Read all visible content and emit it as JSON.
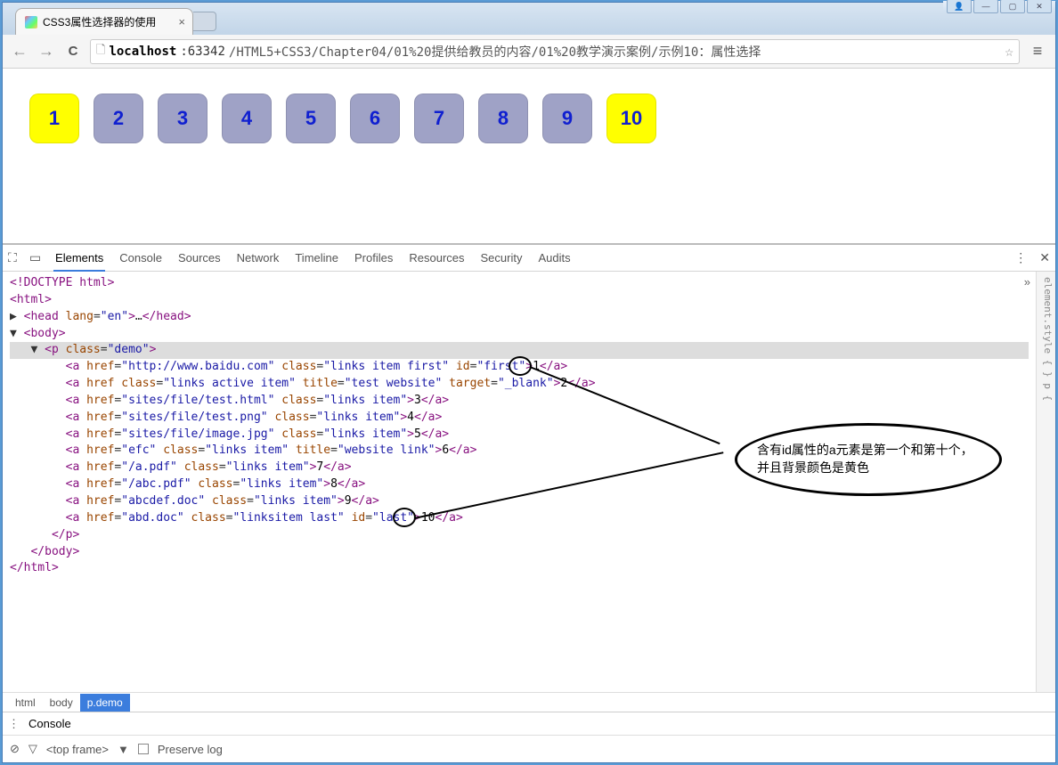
{
  "browser": {
    "tab_title": "CSS3属性选择器的使用",
    "url_host": "localhost",
    "url_port": ":63342",
    "url_path": "/HTML5+CSS3/Chapter04/01%20提供给教员的内容/01%20教学演示案例/示例10：属性选择"
  },
  "demo_items": [
    {
      "label": "1",
      "highlight": true
    },
    {
      "label": "2",
      "highlight": false
    },
    {
      "label": "3",
      "highlight": false
    },
    {
      "label": "4",
      "highlight": false
    },
    {
      "label": "5",
      "highlight": false
    },
    {
      "label": "6",
      "highlight": false
    },
    {
      "label": "7",
      "highlight": false
    },
    {
      "label": "8",
      "highlight": false
    },
    {
      "label": "9",
      "highlight": false
    },
    {
      "label": "10",
      "highlight": true
    }
  ],
  "devtools": {
    "tabs": [
      "Elements",
      "Console",
      "Sources",
      "Network",
      "Timeline",
      "Profiles",
      "Resources",
      "Security",
      "Audits"
    ],
    "active_tab": "Elements",
    "side_text": "element.style { } p {",
    "breadcrumbs": [
      "html",
      "body",
      "p.demo"
    ],
    "console_label": "Console",
    "top_frame": "<top frame>",
    "preserve_log": "Preserve log"
  },
  "source": {
    "doctype": "<!DOCTYPE html>",
    "html_open": "<html>",
    "head": "<head lang=\"en\">…</head>",
    "body_open": "<body>",
    "p_open": "<p class=\"demo\">",
    "links": [
      {
        "href": "http://www.baidu.com",
        "class": "links item first",
        "extra": " id=\"first\"",
        "text": "1"
      },
      {
        "href_attr": "href",
        "class": "links active item",
        "extra": " title=\"test website\" target=\"_blank\"",
        "text": "2"
      },
      {
        "href": "sites/file/test.html",
        "class": "links item",
        "extra": "",
        "text": "3"
      },
      {
        "href": "sites/file/test.png",
        "class": "links item",
        "extra": "",
        "text": "4"
      },
      {
        "href": "sites/file/image.jpg",
        "class": "links item",
        "extra": "",
        "text": "5"
      },
      {
        "href": "efc",
        "class": "links item",
        "extra": " title=\"website link\"",
        "text": "6"
      },
      {
        "href": "/a.pdf",
        "class": "links item",
        "extra": "",
        "text": "7"
      },
      {
        "href": "/abc.pdf",
        "class": "links item",
        "extra": "",
        "text": "8"
      },
      {
        "href": "abcdef.doc",
        "class": "links item",
        "extra": "",
        "text": "9"
      },
      {
        "href": "abd.doc",
        "class": "linksitem last",
        "extra": " id=\"last\"",
        "text": "10"
      }
    ],
    "p_close": "</p>",
    "body_close": "</body>",
    "html_close": "</html>"
  },
  "annotation": {
    "text": "含有id属性的a元素是第一个和第十个，并且背景颜色是黄色"
  }
}
